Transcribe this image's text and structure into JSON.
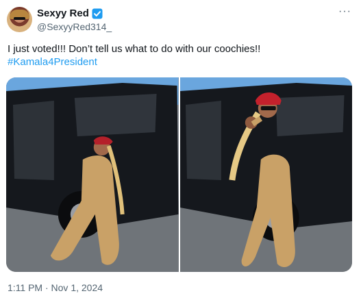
{
  "author": {
    "name": "Sexyy Red",
    "handle": "@SexyyRed314_",
    "verified_icon": "verified-badge-icon",
    "avatar_icon": "profile-avatar"
  },
  "menu": {
    "more_label": "···"
  },
  "tweet": {
    "text": "I just voted!!! Don’t tell us what to do with our coochies!!",
    "hashtag": "#Kamala4President",
    "timestamp": "1:11 PM · Nov 1, 2024"
  },
  "media": {
    "count": 2,
    "photos": [
      {
        "subject": "woman in tan outfit and red cap posing beside black SUV"
      },
      {
        "subject": "woman in tan outfit, red cap and sunglasses posing with raised fist beside black SUV"
      }
    ]
  },
  "colors": {
    "link": "#1d9bf0",
    "secondary_text": "#536471",
    "verified": "#1d9bf0"
  }
}
